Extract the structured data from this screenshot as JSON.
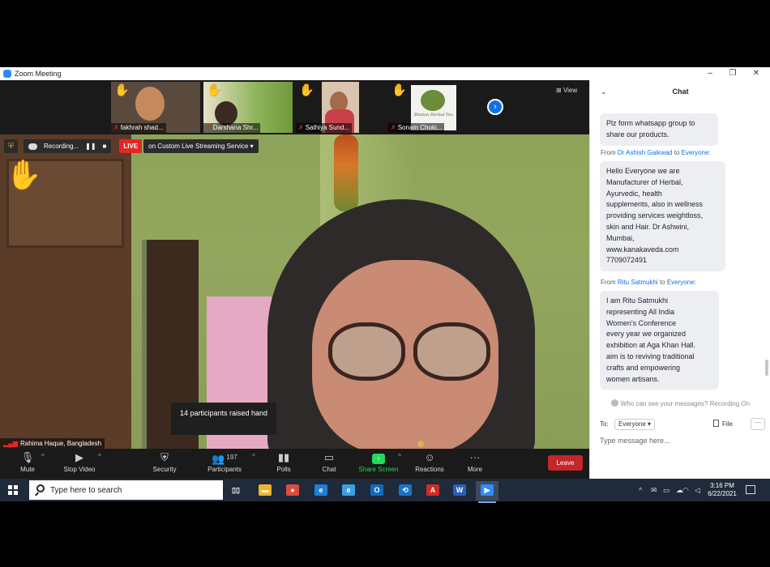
{
  "window": {
    "title": "Zoom Meeting",
    "controls": [
      "–",
      "❐",
      "✕"
    ]
  },
  "thumbnails": [
    {
      "name": "fakhrah shad...",
      "skin": "#c48a5e",
      "bg": "#5a4a3e"
    },
    {
      "name": "Darshana Shr...",
      "skin": "#b07a57",
      "bg": "#8fb35a"
    },
    {
      "name": "Sathiya Sund...",
      "skin": "#a56a4a",
      "bg": "#d9c4b0"
    },
    {
      "name": "Sonam Choki...",
      "skin": "#6b8c3a",
      "bg": "#f2f2ee",
      "logo_text": "Bhutan Herbal Tea"
    }
  ],
  "strip": {
    "view_label": "View",
    "next_icon": "›"
  },
  "recording": {
    "label": "Recording...",
    "pause": "❚❚",
    "stop": "■",
    "live": "LIVE",
    "stream": "on Custom Live Streaming Service"
  },
  "raised_hands_toast": "14 participants raised hand",
  "main_speaker": "Rahima Haque, Bangladesh",
  "toolbar": {
    "mute": "Mute",
    "stop_video": "Stop Video",
    "security": "Security",
    "participants": "Participants",
    "participants_count": "197",
    "polls": "Polls",
    "chat": "Chat",
    "share_screen": "Share Screen",
    "reactions": "Reactions",
    "more": "More",
    "leave": "Leave"
  },
  "chat": {
    "title": "Chat",
    "messages": [
      {
        "from": "",
        "to": "",
        "text": "Plz form whatsapp group to\nshare our products."
      },
      {
        "from": "Dr  Ashish Gaikwad",
        "to": "Everyone:",
        "text": "Hello Everyone  we are\nManufacturer of Herbal,\nAyurvedic, health\nsupplements,  also in wellness\nproviding services weightloss,\nskin and Hair.    Dr Ashwini,\nMumbai,\nwww.kanakaveda.com\n7709072491"
      },
      {
        "from": "Ritu Satmukhi",
        "to": "Everyone:",
        "text": "I am Ritu Satmukhi\nrepresenting All India\nWomen's Conference\nevery year we organized\nexhibition at Aga Khan Hall.\naim is to reviving traditional\ncrafts and empowering\nwomen artisans."
      }
    ],
    "from_prefix": "From",
    "to_word": "to",
    "privacy_note": "Who can see your messages? Recording On",
    "to_label": "To:",
    "to_value": "Everyone",
    "file_label": "File",
    "more_label": "···",
    "input_placeholder": "Type message here..."
  },
  "taskbar": {
    "search_placeholder": "Type here to search",
    "apps": [
      {
        "name": "task-view",
        "glyph": "▯▯",
        "color": "#1f2a3a"
      },
      {
        "name": "file-explorer",
        "glyph": "▬",
        "color": "#f0b429"
      },
      {
        "name": "chrome",
        "glyph": "●",
        "color": "#e04a3b"
      },
      {
        "name": "edge",
        "glyph": "e",
        "color": "#1f7fd6"
      },
      {
        "name": "internet-explorer",
        "glyph": "e",
        "color": "#3aa0e6"
      },
      {
        "name": "outlook",
        "glyph": "O",
        "color": "#0f6cbd"
      },
      {
        "name": "teamviewer",
        "glyph": "⟲",
        "color": "#1a73c8"
      },
      {
        "name": "acrobat",
        "glyph": "A",
        "color": "#d42a20"
      },
      {
        "name": "word",
        "glyph": "W",
        "color": "#2b5eb7"
      },
      {
        "name": "zoom",
        "glyph": "▶",
        "color": "#2d8cff"
      }
    ],
    "time": "3:16 PM",
    "date": "6/22/2021"
  },
  "colors": {
    "zoom_blue": "#0e71eb",
    "live_red": "#e02828",
    "share_green": "#23d959",
    "leave_red": "#c4262c"
  }
}
